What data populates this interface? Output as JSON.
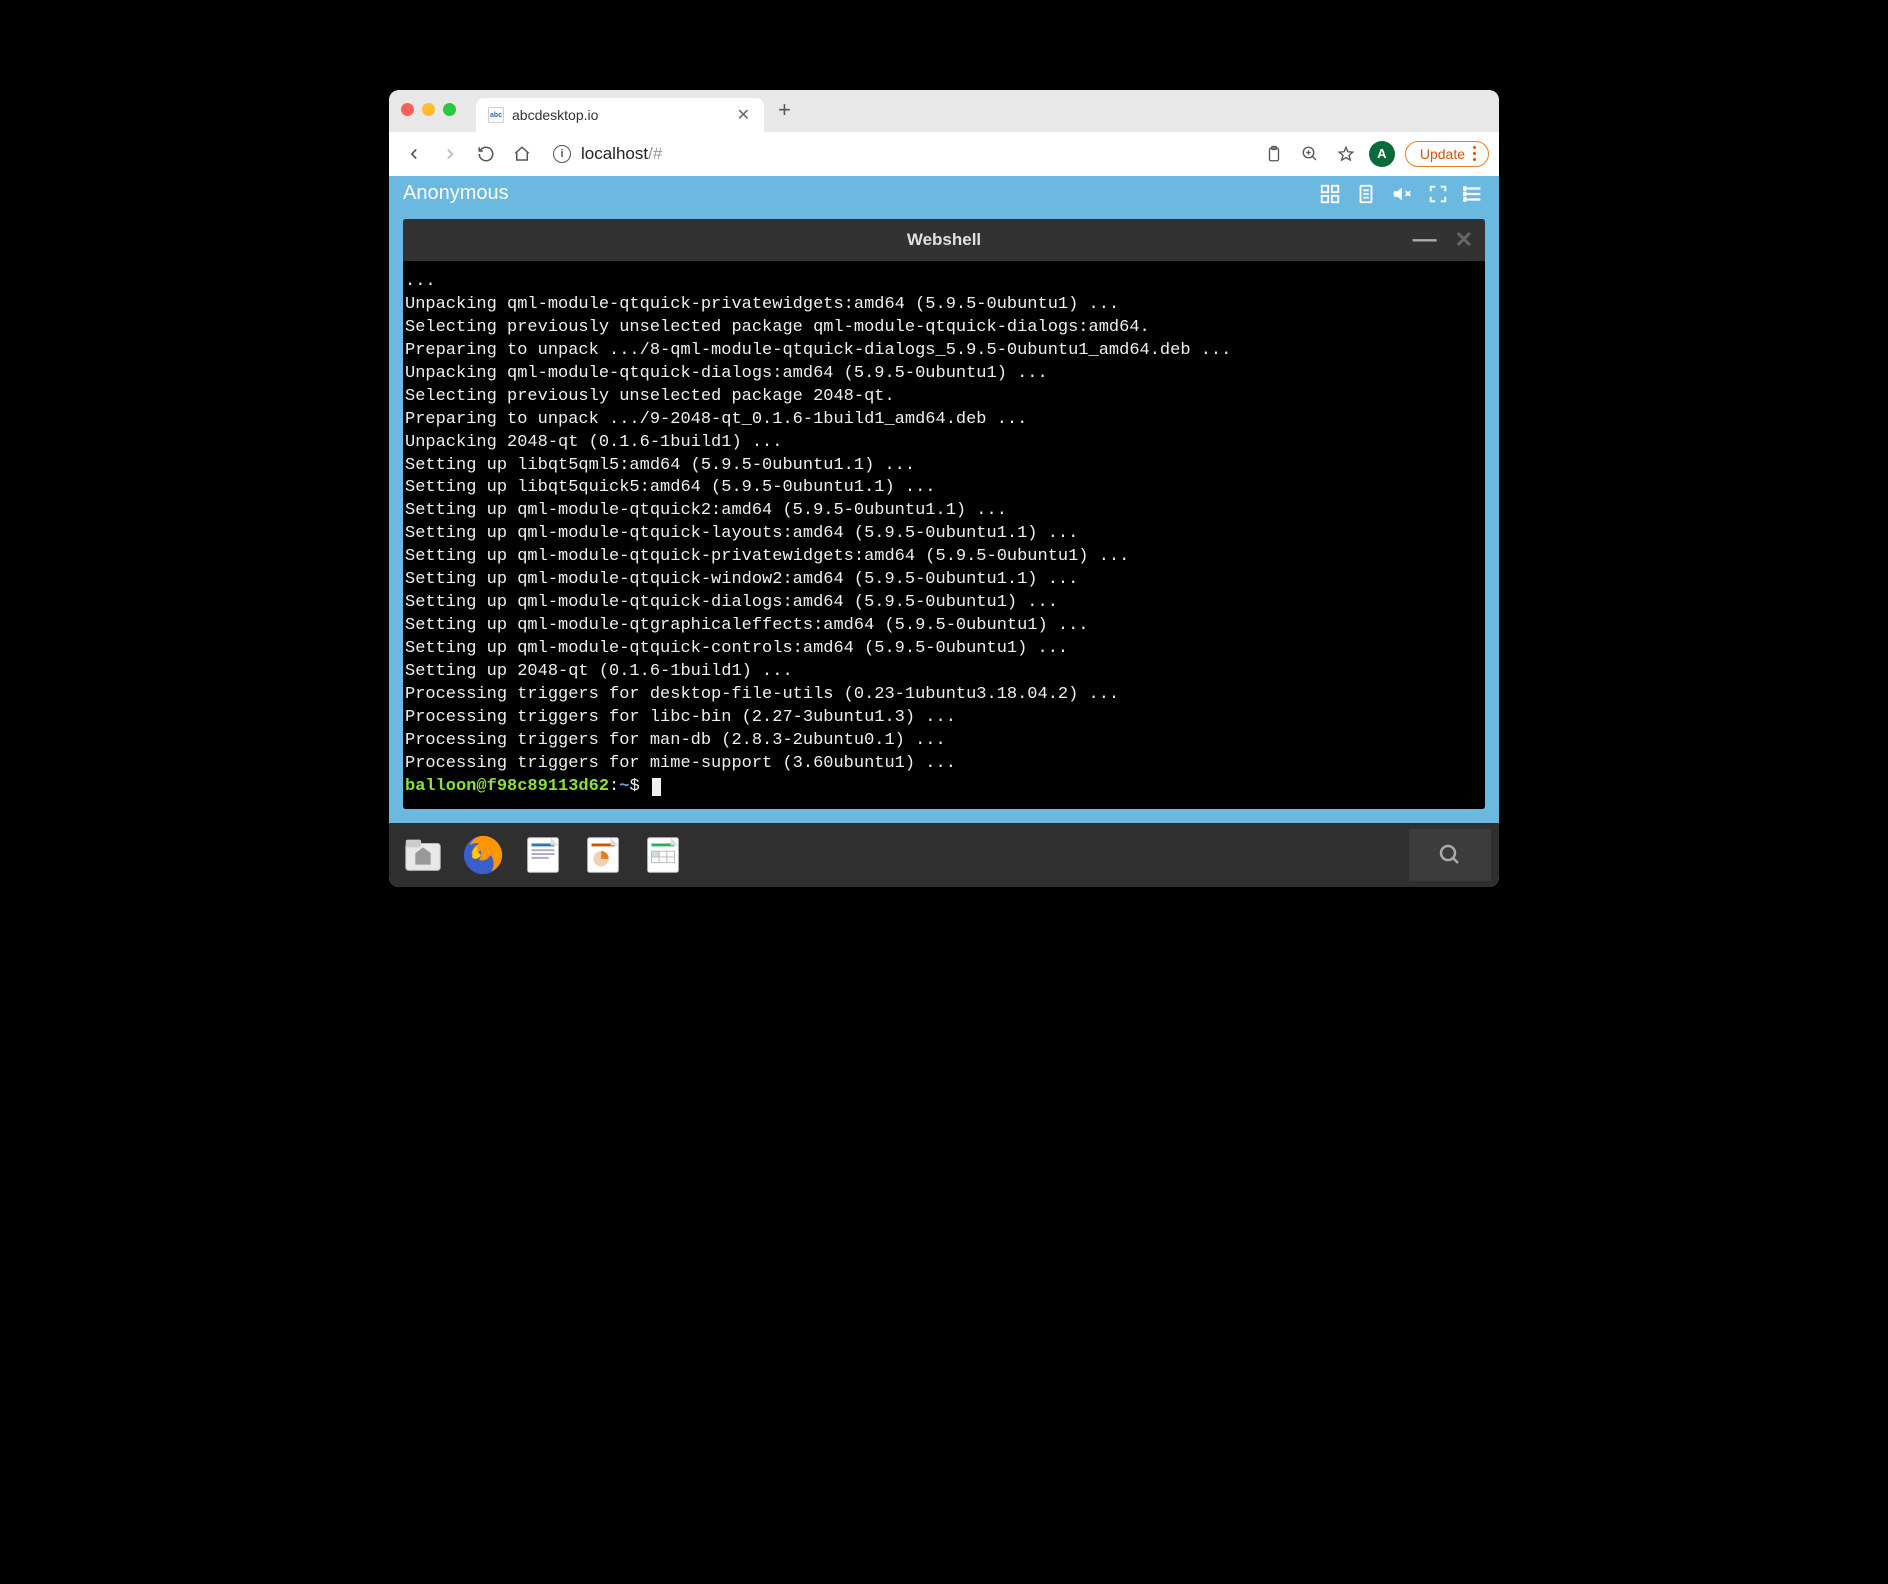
{
  "browser": {
    "tab": {
      "title": "abcdesktop.io",
      "favicon_label": "abc"
    },
    "url_host": "localhost",
    "url_path": "/#",
    "profile_initial": "A",
    "update_label": "Update"
  },
  "desktop": {
    "header_label": "Anonymous"
  },
  "terminal": {
    "title": "Webshell",
    "lines": [
      "...",
      "Unpacking qml-module-qtquick-privatewidgets:amd64 (5.9.5-0ubuntu1) ...",
      "Selecting previously unselected package qml-module-qtquick-dialogs:amd64.",
      "Preparing to unpack .../8-qml-module-qtquick-dialogs_5.9.5-0ubuntu1_amd64.deb ...",
      "Unpacking qml-module-qtquick-dialogs:amd64 (5.9.5-0ubuntu1) ...",
      "Selecting previously unselected package 2048-qt.",
      "Preparing to unpack .../9-2048-qt_0.1.6-1build1_amd64.deb ...",
      "Unpacking 2048-qt (0.1.6-1build1) ...",
      "Setting up libqt5qml5:amd64 (5.9.5-0ubuntu1.1) ...",
      "Setting up libqt5quick5:amd64 (5.9.5-0ubuntu1.1) ...",
      "Setting up qml-module-qtquick2:amd64 (5.9.5-0ubuntu1.1) ...",
      "Setting up qml-module-qtquick-layouts:amd64 (5.9.5-0ubuntu1.1) ...",
      "Setting up qml-module-qtquick-privatewidgets:amd64 (5.9.5-0ubuntu1) ...",
      "Setting up qml-module-qtquick-window2:amd64 (5.9.5-0ubuntu1.1) ...",
      "Setting up qml-module-qtquick-dialogs:amd64 (5.9.5-0ubuntu1) ...",
      "Setting up qml-module-qtgraphicaleffects:amd64 (5.9.5-0ubuntu1) ...",
      "Setting up qml-module-qtquick-controls:amd64 (5.9.5-0ubuntu1) ...",
      "Setting up 2048-qt (0.1.6-1build1) ...",
      "Processing triggers for desktop-file-utils (0.23-1ubuntu3.18.04.2) ...",
      "Processing triggers for libc-bin (2.27-3ubuntu1.3) ...",
      "Processing triggers for man-db (2.8.3-2ubuntu0.1) ...",
      "Processing triggers for mime-support (3.60ubuntu1) ..."
    ],
    "prompt": {
      "user_host": "balloon@f98c89113d62",
      "path": "~",
      "symbol": "$"
    }
  },
  "dock": {
    "items": [
      "files",
      "firefox",
      "writer",
      "impress",
      "calc"
    ]
  }
}
